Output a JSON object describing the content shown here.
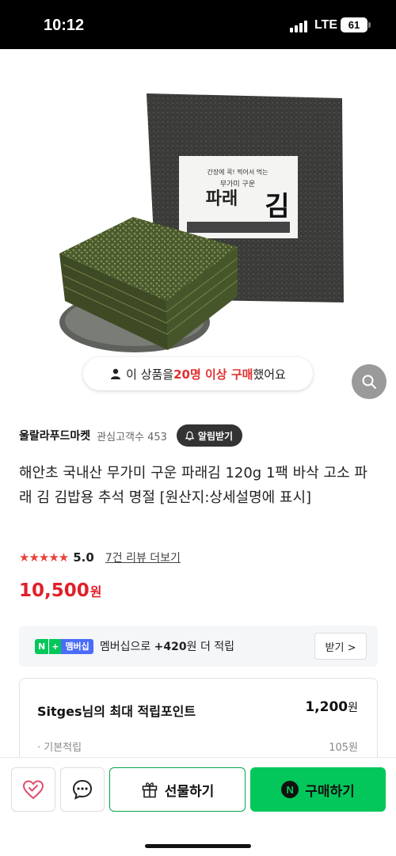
{
  "status_bar": {
    "time": "10:12",
    "network": "LTE",
    "battery": "61"
  },
  "product_image": {
    "package_tagline": "간장에 콕! 찍어서 먹는",
    "package_subtitle": "무가미 구운",
    "package_title_a": "파래",
    "package_title_b": "김",
    "purchase_notice": {
      "prefix": "이 상품을 ",
      "highlight": "20명 이상 구매",
      "suffix": " 했어요"
    }
  },
  "seller": {
    "name": "울랄라푸드마켓",
    "fans": "관심고객수 453",
    "alarm_label": "알림받기"
  },
  "product": {
    "title": "해안초 국내산 무가미 구운 파래김 120g 1팩 바삭 고소 파래 김 김밥용 추석 명절 [원산지:상세설명에 표시]",
    "stars": "★★★★★",
    "rating": "5.0",
    "review_link": "7건 리뷰 더보기",
    "price": "10,500",
    "currency": "원"
  },
  "membership": {
    "badge_n": "N",
    "badge_plus": "+",
    "badge_label": "멤버십",
    "text_prefix": "멤버십으로 ",
    "points": "+420",
    "text_suffix": "원 더 적립",
    "receive_label": "받기 >"
  },
  "points_card": {
    "title": "Sitges님의 최대 적립포인트",
    "value": "1,200",
    "unit": "원",
    "base_label": "기본적립",
    "base_value": "105원"
  },
  "bottom_bar": {
    "gift_label": "선물하기",
    "buy_label": "구매하기",
    "npay_letter": "N"
  },
  "colors": {
    "price_red": "#e0202a",
    "naver_green": "#03c75a",
    "star_red": "#e8423b"
  }
}
